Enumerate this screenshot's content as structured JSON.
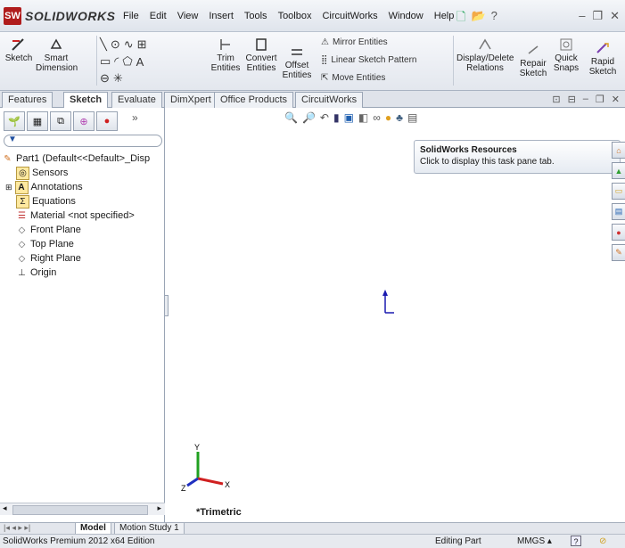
{
  "app": {
    "logo_mark": "SW",
    "logo_word": "SOLIDWORKS"
  },
  "menus": [
    "File",
    "Edit",
    "View",
    "Insert",
    "Tools",
    "Toolbox",
    "CircuitWorks",
    "Window",
    "Help"
  ],
  "commands": {
    "sketch": "Sketch",
    "smart_dimension": "Smart Dimension",
    "trim_entities": "Trim Entities",
    "convert_entities": "Convert Entities",
    "offset_entities": "Offset Entities",
    "mirror_entities": "Mirror Entities",
    "linear_sketch_pattern": "Linear Sketch Pattern",
    "move_entities": "Move Entities",
    "display_delete_relations": "Display/Delete Relations",
    "repair_sketch": "Repair Sketch",
    "quick_snaps": "Quick Snaps",
    "rapid_sketch": "Rapid Sketch"
  },
  "tabs": [
    "Features",
    "Sketch",
    "Evaluate",
    "DimXpert",
    "Office Products",
    "CircuitWorks"
  ],
  "active_tab": "Sketch",
  "tree": {
    "root": "Part1  (Default<<Default>_Disp",
    "items": [
      "Sensors",
      "Annotations",
      "Equations",
      "Material <not specified>",
      "Front Plane",
      "Top Plane",
      "Right Plane",
      "Origin"
    ]
  },
  "tooltip": {
    "title": "SolidWorks Resources",
    "body": "Click to display this task pane tab."
  },
  "view": {
    "orientation": "*Trimetric",
    "triad_x": "X",
    "triad_y": "Y",
    "triad_z": "Z"
  },
  "model_tabs": [
    "Model",
    "Motion Study 1"
  ],
  "status": {
    "edition": "SolidWorks Premium 2012 x64 Edition",
    "mode": "Editing Part",
    "units": "MMGS"
  },
  "colors": {
    "brand": "#b01c1c",
    "triad_x": "#d02020",
    "triad_y": "#20a020",
    "triad_z": "#2030c0"
  }
}
